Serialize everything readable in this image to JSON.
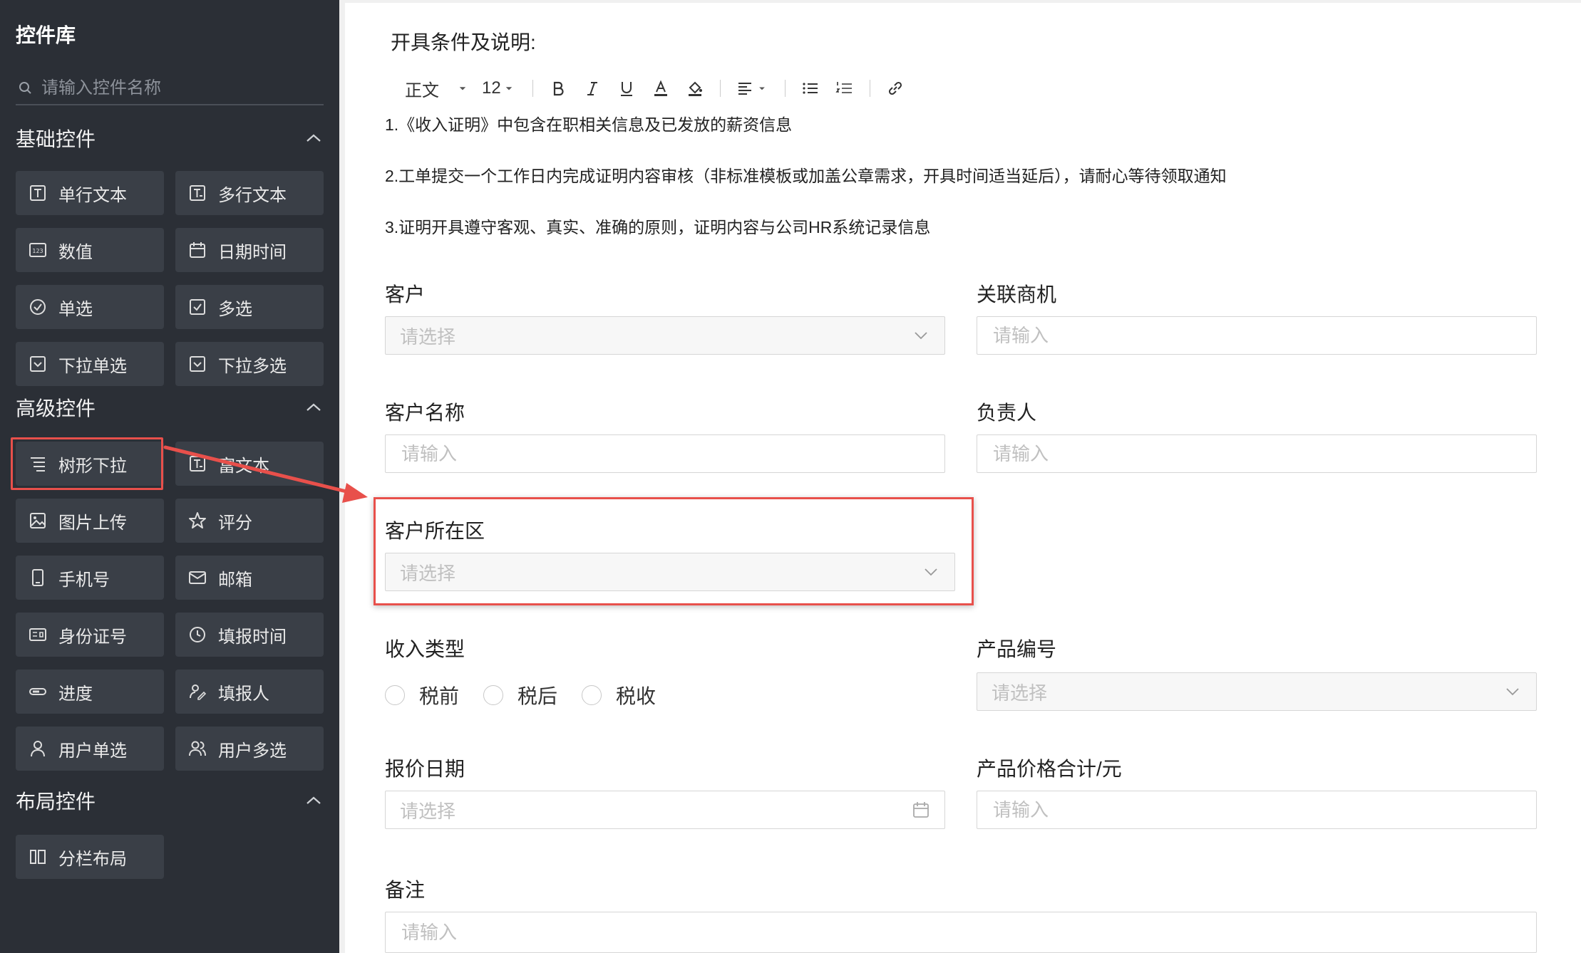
{
  "sidebar": {
    "title": "控件库",
    "search_placeholder": "请输入控件名称",
    "sections": {
      "basic": "基础控件",
      "advanced": "高级控件",
      "layout": "布局控件"
    },
    "basic_items": [
      "单行文本",
      "多行文本",
      "数值",
      "日期时间",
      "单选",
      "多选",
      "下拉单选",
      "下拉多选"
    ],
    "advanced_items": [
      "树形下拉",
      "富文本",
      "图片上传",
      "评分",
      "手机号",
      "邮箱",
      "身份证号",
      "填报时间",
      "进度",
      "填报人",
      "用户单选",
      "用户多选"
    ],
    "layout_items": [
      "分栏布局"
    ]
  },
  "form": {
    "intro_title": "开具条件及说明:",
    "toolbar": {
      "style": "正文",
      "size": "12"
    },
    "intro_lines": [
      "1.《收入证明》中包含在职相关信息及已发放的薪资信息",
      "2.工单提交一个工作日内完成证明内容审核（非标准模板或加盖公章需求，开具时间适当延后），请耐心等待领取通知",
      "3.证明开具遵守客观、真实、准确的原则，证明内容与公司HR系统记录信息"
    ],
    "fields": {
      "customer": {
        "label": "客户",
        "placeholder": "请选择"
      },
      "opportunity": {
        "label": "关联商机",
        "placeholder": "请输入"
      },
      "customer_name": {
        "label": "客户名称",
        "placeholder": "请输入"
      },
      "owner": {
        "label": "负责人",
        "placeholder": "请输入"
      },
      "region": {
        "label": "客户所在区",
        "placeholder": "请选择"
      },
      "income_type": {
        "label": "收入类型",
        "options": [
          "税前",
          "税后",
          "税收"
        ]
      },
      "product_code": {
        "label": "产品编号",
        "placeholder": "请选择"
      },
      "quote_date": {
        "label": "报价日期",
        "placeholder": "请选择"
      },
      "price_total": {
        "label": "产品价格合计/元",
        "placeholder": "请输入"
      },
      "remark": {
        "label": "备注",
        "placeholder": "请输入"
      }
    }
  },
  "colors": {
    "sidebar_bg": "#2b2f36",
    "button_bg": "#3a3f47",
    "highlight": "#e8504b"
  }
}
